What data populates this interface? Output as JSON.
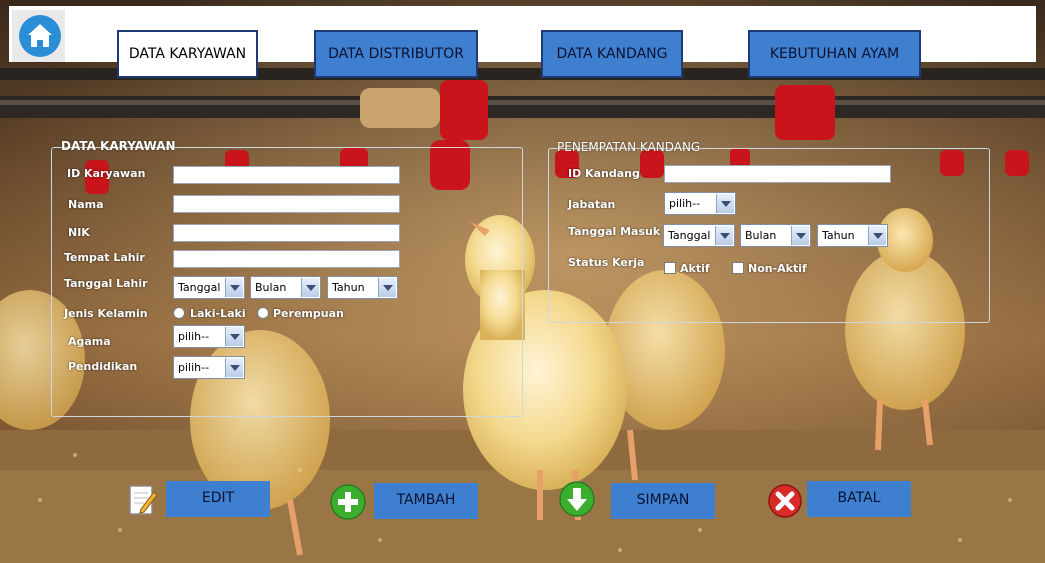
{
  "nav": {
    "home_icon": "home-icon",
    "tabs": [
      {
        "label": "DATA KARYAWAN",
        "active": true
      },
      {
        "label": "DATA DISTRIBUTOR",
        "active": false
      },
      {
        "label": "DATA KANDANG",
        "active": false
      },
      {
        "label": "KEBUTUHAN AYAM",
        "active": false
      }
    ]
  },
  "karyawan": {
    "title": "DATA KARYAWAN",
    "id_label": "ID Karyawan",
    "nama_label": "Nama",
    "nik_label": "NIK",
    "tempat_lahir_label": "Tempat Lahir",
    "tanggal_lahir_label": "Tanggal Lahir",
    "tanggal_options": {
      "day": "Tanggal",
      "month": "Bulan",
      "year": "Tahun"
    },
    "jenis_kelamin_label": "Jenis Kelamin",
    "gender_options": [
      "Laki-Laki",
      "Perempuan"
    ],
    "agama_label": "Agama",
    "agama_value": "pilih--",
    "pendidikan_label": "Pendidikan",
    "pendidikan_value": "pilih--"
  },
  "penempatan": {
    "title": "PENEMPATAN KANDANG",
    "id_kandang_label": "ID Kandang",
    "jabatan_label": "Jabatan",
    "jabatan_value": "pilih--",
    "tanggal_masuk_label": "Tanggal Masuk",
    "tanggal_options": {
      "day": "Tanggal",
      "month": "Bulan",
      "year": "Tahun"
    },
    "status_label": "Status Kerja",
    "status_options": [
      "Aktif",
      "Non-Aktif"
    ]
  },
  "actions": {
    "edit": "EDIT",
    "tambah": "TAMBAH",
    "simpan": "SIMPAN",
    "batal": "BATAL"
  },
  "colors": {
    "tab_blue": "#3f7fcf",
    "tab_border": "#1e3a74",
    "home_blue": "#2a8fd6",
    "add_green": "#3cae2e",
    "cancel_red": "#d92a2a"
  }
}
